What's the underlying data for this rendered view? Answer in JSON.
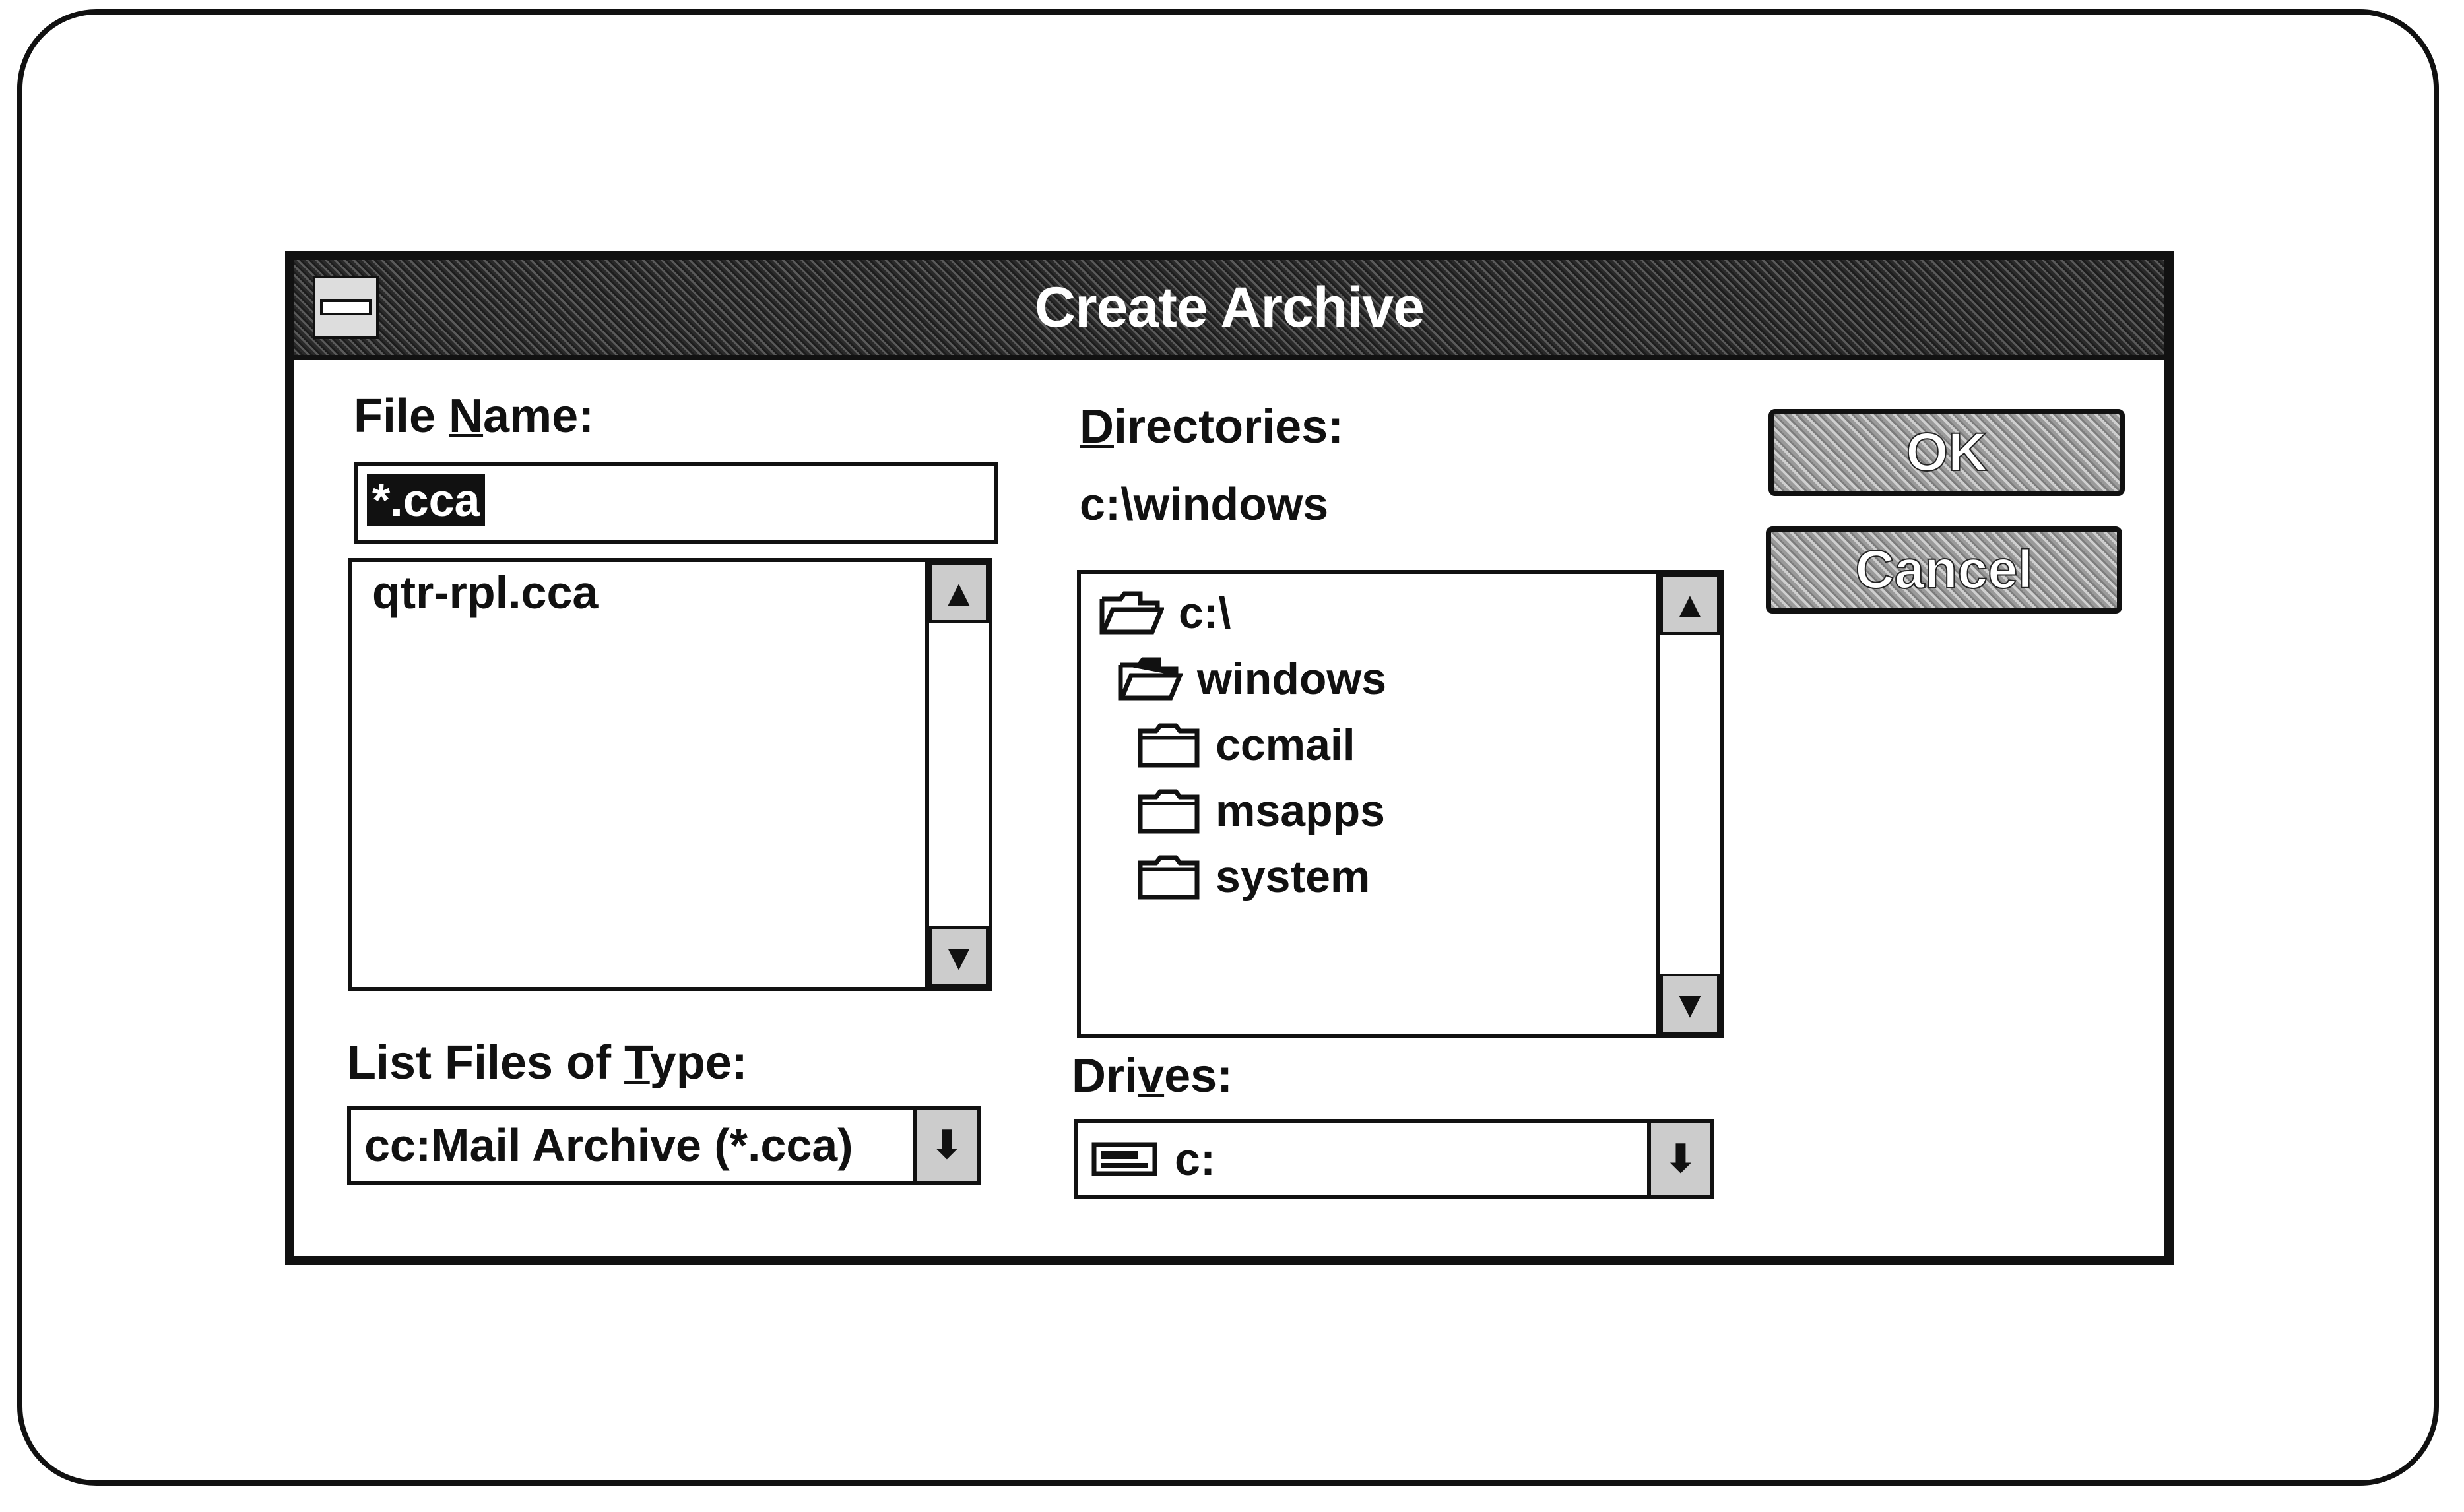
{
  "dialog": {
    "title": "Create Archive"
  },
  "file_name": {
    "label_pre": "File ",
    "label_accel": "N",
    "label_post": "ame:",
    "value": "*.cca",
    "files": [
      "qtr-rpl.cca"
    ]
  },
  "file_type": {
    "label_pre": "List Files of ",
    "label_accel": "T",
    "label_post": "ype:",
    "selected": "cc:Mail Archive (*.cca)"
  },
  "directories": {
    "label_pre": "",
    "label_accel": "D",
    "label_post": "irectories:",
    "current_path": "c:\\windows",
    "items": [
      {
        "name": "c:\\",
        "icon": "open-folder-icon"
      },
      {
        "name": "windows",
        "icon": "open-folder-icon"
      },
      {
        "name": "ccmail",
        "icon": "folder-icon"
      },
      {
        "name": "msapps",
        "icon": "folder-icon"
      },
      {
        "name": "system",
        "icon": "folder-icon"
      }
    ]
  },
  "drives": {
    "label_pre": "Dri",
    "label_accel": "v",
    "label_post": "es:",
    "selected": "c:",
    "icon": "hard-drive-icon"
  },
  "buttons": {
    "ok": "OK",
    "cancel": "Cancel"
  },
  "icons": {
    "scroll_up": "▲",
    "scroll_down": "▼",
    "dropdown": "⬇"
  }
}
